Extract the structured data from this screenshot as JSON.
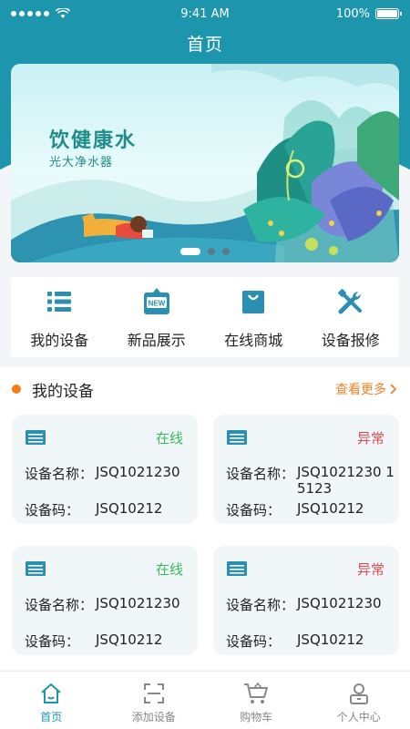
{
  "status_bar": {
    "time": "9:41 AM",
    "battery": "100%"
  },
  "page_title": "首页",
  "banner": {
    "title": "饮健康水",
    "subtitle": "光大净水器",
    "active_slide": 1,
    "slide_count": 3
  },
  "quick_actions": [
    {
      "label": "我的设备",
      "icon": "device-list-icon"
    },
    {
      "label": "新品展示",
      "icon": "new-badge-icon",
      "badge": "NEW"
    },
    {
      "label": "在线商城",
      "icon": "shopping-bag-icon"
    },
    {
      "label": "设备报修",
      "icon": "repair-tools-icon"
    }
  ],
  "devices_section": {
    "title": "我的设备",
    "more": "查看更多",
    "cards": [
      {
        "status": "在线",
        "status_type": "online",
        "name_label": "设备名称：",
        "name": "JSQ1021230",
        "code_label": "设备码：",
        "code": "JSQ10212"
      },
      {
        "status": "异常",
        "status_type": "abnormal",
        "name_label": "设备名称：",
        "name": "JSQ1021230 15123",
        "code_label": "设备码：",
        "code": "JSQ10212"
      },
      {
        "status": "在线",
        "status_type": "online",
        "name_label": "设备名称：",
        "name": "JSQ1021230",
        "code_label": "设备码：",
        "code": "JSQ10212"
      },
      {
        "status": "异常",
        "status_type": "abnormal",
        "name_label": "设备名称：",
        "name": "JSQ1021230",
        "code_label": "设备码：",
        "code": "JSQ10212"
      }
    ]
  },
  "tabbar": [
    {
      "label": "首页",
      "icon": "home-icon",
      "active": true
    },
    {
      "label": "添加设备",
      "icon": "scan-icon",
      "active": false
    },
    {
      "label": "购物车",
      "icon": "cart-icon",
      "active": false
    },
    {
      "label": "个人中心",
      "icon": "user-icon",
      "active": false
    }
  ],
  "colors": {
    "primary": "#1d96ad",
    "online": "#3ab95c",
    "abnormal": "#e24c4c",
    "accent": "#f08228"
  }
}
